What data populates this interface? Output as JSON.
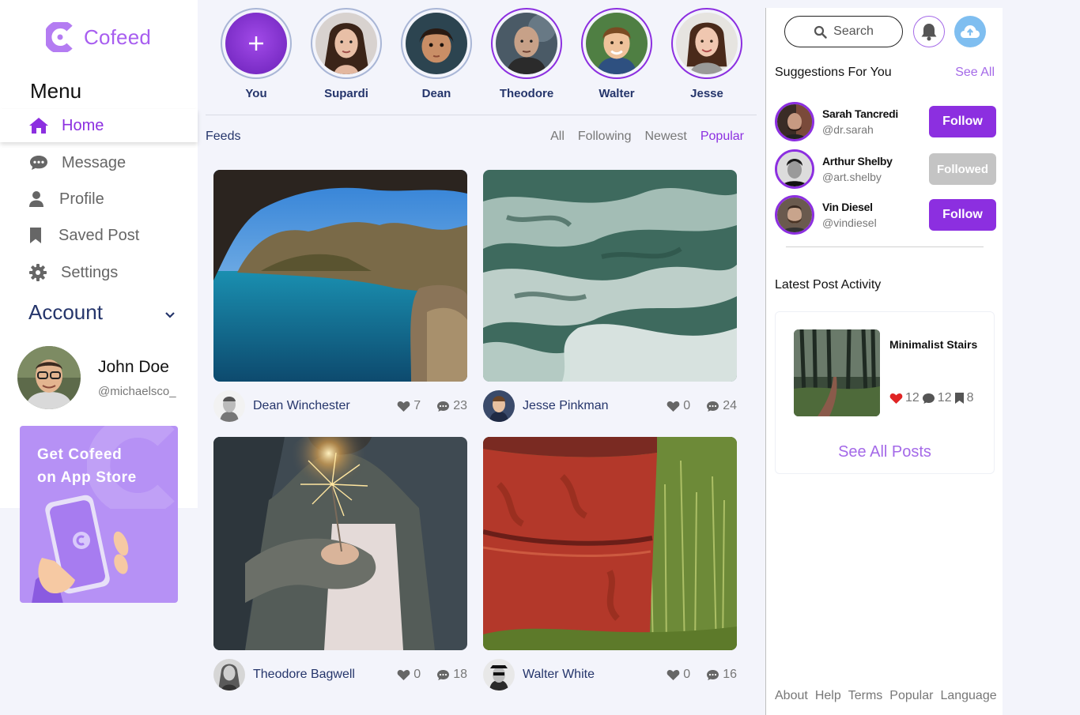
{
  "brand": {
    "name": "Cofeed",
    "accent": "#8c2fe0",
    "light_accent": "#a469e8"
  },
  "menu": {
    "title": "Menu",
    "items": [
      {
        "label": "Home",
        "icon": "home-icon",
        "active": true
      },
      {
        "label": "Message",
        "icon": "chat-icon",
        "active": false
      },
      {
        "label": "Profile",
        "icon": "user-icon",
        "active": false
      },
      {
        "label": "Saved Post",
        "icon": "bookmark-icon",
        "active": false
      },
      {
        "label": "Settings",
        "icon": "gear-icon",
        "active": false
      }
    ]
  },
  "account": {
    "label": "Account",
    "icon": "chevron-down-icon"
  },
  "user": {
    "name": "John Doe",
    "handle": "@michaelsco_"
  },
  "promo": {
    "line1": "Get Cofeed",
    "line2": "on App Store"
  },
  "stories": [
    {
      "label": "You",
      "type": "add"
    },
    {
      "label": "Supardi",
      "type": "user"
    },
    {
      "label": "Dean",
      "type": "user"
    },
    {
      "label": "Theodore",
      "type": "user"
    },
    {
      "label": "Walter",
      "type": "user"
    },
    {
      "label": "Jesse",
      "type": "user"
    }
  ],
  "feeds": {
    "label": "Feeds",
    "filters": [
      "All",
      "Following",
      "Newest",
      "Popular"
    ],
    "active_filter": "Popular",
    "posts": [
      {
        "author": "Dean Winchester",
        "likes": "7",
        "comments": "23"
      },
      {
        "author": "Jesse Pinkman",
        "likes": "0",
        "comments": "24"
      },
      {
        "author": "Theodore Bagwell",
        "likes": "0",
        "comments": "18"
      },
      {
        "author": "Walter White",
        "likes": "0",
        "comments": "16"
      }
    ]
  },
  "header": {
    "search_label": "Search"
  },
  "suggestions": {
    "title": "Suggestions For You",
    "see_all": "See All",
    "people": [
      {
        "name": "Sarah Tancredi",
        "handle": "@dr.sarah",
        "button": "Follow",
        "followed": false
      },
      {
        "name": "Arthur Shelby",
        "handle": "@art.shelby",
        "button": "Followed",
        "followed": true
      },
      {
        "name": "Vin Diesel",
        "handle": "@vindiesel",
        "button": "Follow",
        "followed": false
      }
    ]
  },
  "latest": {
    "title": "Latest Post Activity",
    "post_name": "Minimalist Stairs",
    "likes": "12",
    "comments": "12",
    "saves": "8",
    "see_all_posts": "See All Posts"
  },
  "footer": [
    "About",
    "Help",
    "Terms",
    "Popular",
    "Language"
  ]
}
